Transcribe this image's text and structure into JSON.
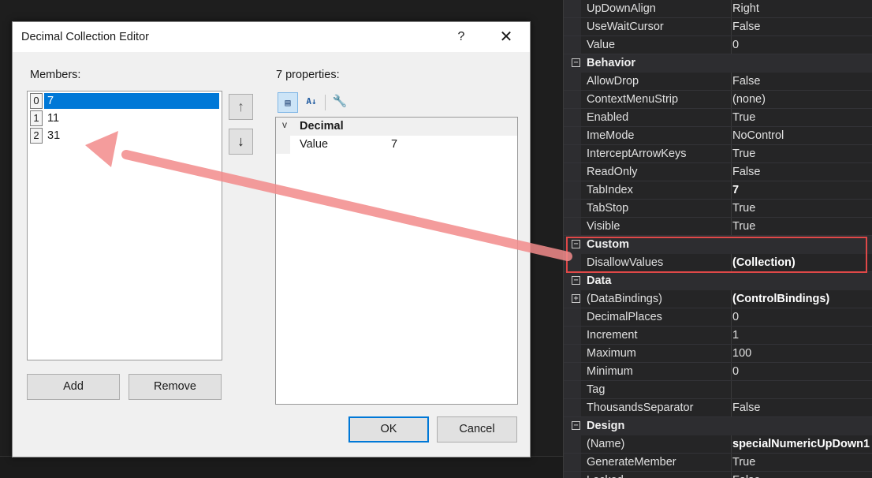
{
  "dialog": {
    "title": "Decimal Collection Editor",
    "help_label": "?",
    "close_label": "✕",
    "members_label": "Members:",
    "members": [
      {
        "index": "0",
        "value": "7"
      },
      {
        "index": "1",
        "value": "11"
      },
      {
        "index": "2",
        "value": "31"
      }
    ],
    "move_up_label": "↑",
    "move_down_label": "↓",
    "add_label": "Add",
    "remove_label": "Remove",
    "properties_label": "7 properties:",
    "toolbar": {
      "categorized_glyph": "▤",
      "alphabetical_glyph": "A↓",
      "property_pages_glyph": "🔧"
    },
    "props": {
      "category": "Decimal",
      "chevron": "v",
      "row_name": "Value",
      "row_value": "7"
    },
    "ok_label": "OK",
    "cancel_label": "Cancel"
  },
  "property_grid": {
    "rows": [
      {
        "type": "prop",
        "name": "UpDownAlign",
        "value": "Right"
      },
      {
        "type": "prop",
        "name": "UseWaitCursor",
        "value": "False"
      },
      {
        "type": "prop",
        "name": "Value",
        "value": "0"
      },
      {
        "type": "cat",
        "name": "Behavior"
      },
      {
        "type": "prop",
        "name": "AllowDrop",
        "value": "False"
      },
      {
        "type": "prop",
        "name": "ContextMenuStrip",
        "value": "(none)"
      },
      {
        "type": "prop",
        "name": "Enabled",
        "value": "True"
      },
      {
        "type": "prop",
        "name": "ImeMode",
        "value": "NoControl"
      },
      {
        "type": "prop",
        "name": "InterceptArrowKeys",
        "value": "True"
      },
      {
        "type": "prop",
        "name": "ReadOnly",
        "value": "False"
      },
      {
        "type": "prop",
        "name": "TabIndex",
        "value": "7",
        "bold": true
      },
      {
        "type": "prop",
        "name": "TabStop",
        "value": "True"
      },
      {
        "type": "prop",
        "name": "Visible",
        "value": "True"
      },
      {
        "type": "cat",
        "name": "Custom"
      },
      {
        "type": "prop",
        "name": "DisallowValues",
        "value": "(Collection)",
        "bold": true
      },
      {
        "type": "cat",
        "name": "Data"
      },
      {
        "type": "prop",
        "name": "(DataBindings)",
        "value": "(ControlBindings)",
        "bold": true,
        "expandable": true
      },
      {
        "type": "prop",
        "name": "DecimalPlaces",
        "value": "0"
      },
      {
        "type": "prop",
        "name": "Increment",
        "value": "1"
      },
      {
        "type": "prop",
        "name": "Maximum",
        "value": "100"
      },
      {
        "type": "prop",
        "name": "Minimum",
        "value": "0"
      },
      {
        "type": "prop",
        "name": "Tag",
        "value": ""
      },
      {
        "type": "prop",
        "name": "ThousandsSeparator",
        "value": "False"
      },
      {
        "type": "cat",
        "name": "Design"
      },
      {
        "type": "prop",
        "name": "(Name)",
        "value": "specialNumericUpDown1",
        "bold": true
      },
      {
        "type": "prop",
        "name": "GenerateMember",
        "value": "True"
      },
      {
        "type": "prop",
        "name": "Locked",
        "value": "False"
      }
    ],
    "collapse_glyph": "−",
    "expand_glyph": "+"
  },
  "colors": {
    "accent": "#0078d7",
    "highlight_box": "#e04848",
    "annotation_arrow": "#f28b8b"
  }
}
